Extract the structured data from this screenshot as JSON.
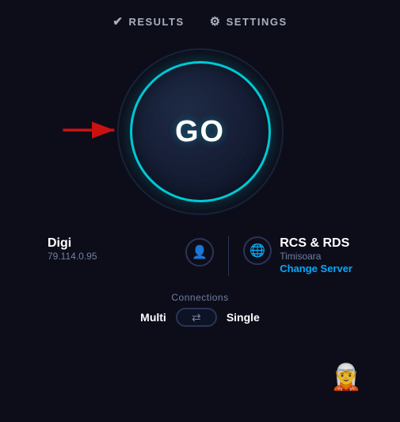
{
  "nav": {
    "results_label": "RESULTS",
    "settings_label": "SETTINGS"
  },
  "go_button": {
    "label": "GO"
  },
  "user_info": {
    "name": "Digi",
    "ip": "79.114.0.95"
  },
  "server_info": {
    "name": "RCS & RDS",
    "location": "Timisoara",
    "change_label": "Change Server"
  },
  "connections": {
    "label": "Connections",
    "multi": "Multi",
    "single": "Single"
  },
  "colors": {
    "accent": "#00c8d4",
    "link": "#00aaff",
    "bg": "#0d0d1a"
  }
}
